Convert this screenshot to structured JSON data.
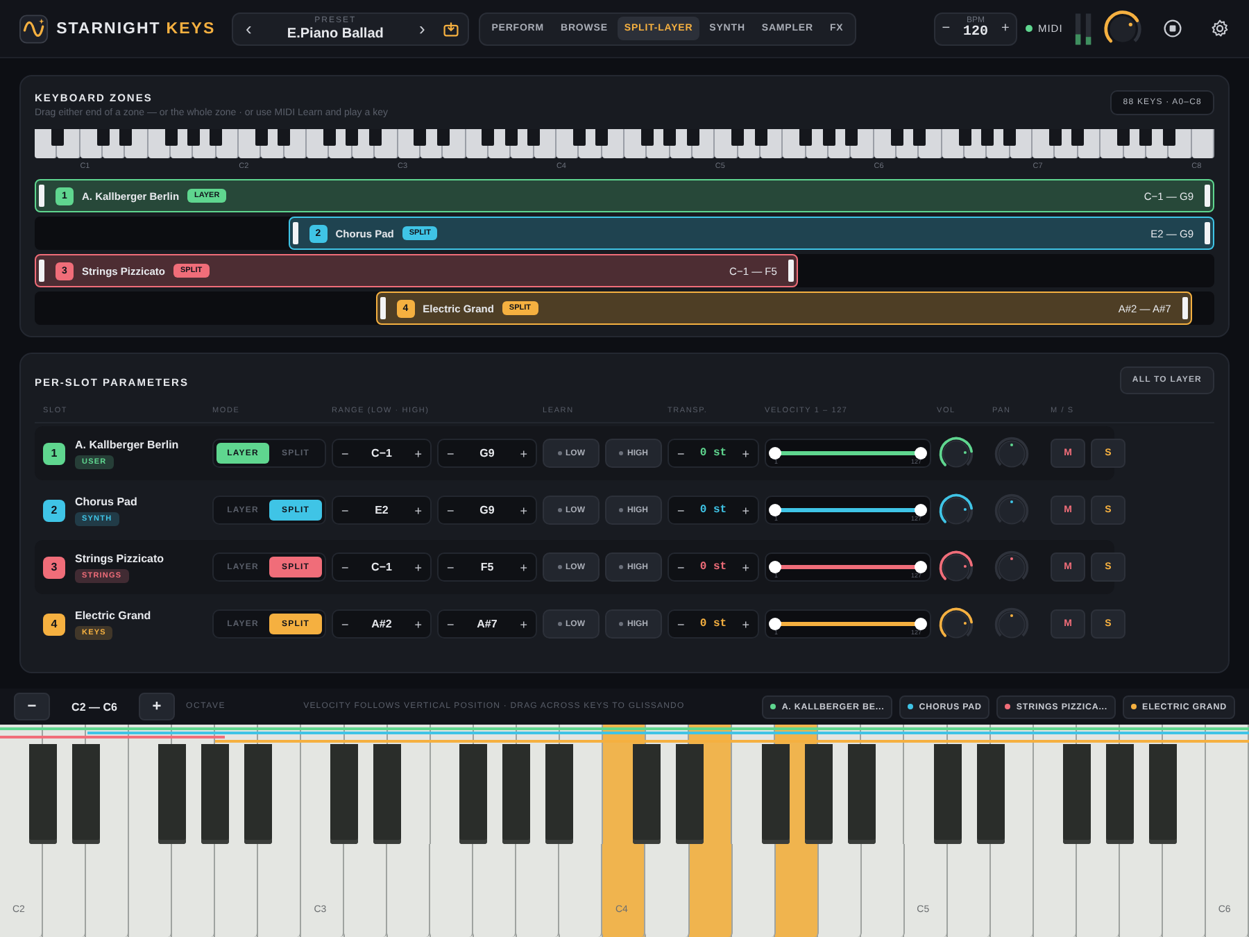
{
  "header": {
    "logo_text": "STARNIGHT",
    "logo_accent": "KEYS",
    "preset": {
      "prev": "‹",
      "label": "PRESET",
      "name": "E.Piano Ballad",
      "next": "›"
    },
    "tabs": [
      {
        "label": "PERFORM",
        "selected": false
      },
      {
        "label": "BROWSE",
        "selected": false
      },
      {
        "label": "SPLIT-LAYER",
        "selected": true
      },
      {
        "label": "SYNTH",
        "selected": false
      },
      {
        "label": "SAMPLER",
        "selected": false
      },
      {
        "label": "FX",
        "selected": false
      }
    ],
    "bpm": {
      "minus": "−",
      "label": "BPM",
      "value": "120",
      "plus": "+"
    },
    "midi": {
      "label": "MIDI",
      "on": true
    },
    "master": {
      "level": 0.72
    }
  },
  "zones_panel": {
    "title": "KEYBOARD ZONES",
    "subtitle": "Drag either end of a zone — or the whole zone · or use MIDI Learn and play a key",
    "badge": "88 KEYS · A0–C8",
    "octave_labels": [
      "C1",
      "C2",
      "C3",
      "C4",
      "C5",
      "C6",
      "C7",
      "C8"
    ],
    "zones": [
      {
        "number": "1",
        "name": "A. Kallberger Berlin",
        "mode": "LAYER",
        "range": "C−1 — G9",
        "color": "#5fd68f"
      },
      {
        "number": "2",
        "name": "Chorus Pad",
        "mode": "SPLIT",
        "range": "E2 — G9",
        "color": "#3fc4e6"
      },
      {
        "number": "3",
        "name": "Strings Pizzicato",
        "mode": "SPLIT",
        "range": "C−1 — F5",
        "color": "#f06d79"
      },
      {
        "number": "4",
        "name": "Electric Grand",
        "mode": "SPLIT",
        "range": "A#2 — A#7",
        "color": "#f5b040"
      }
    ]
  },
  "params_panel": {
    "title": "PER-SLOT PARAMETERS",
    "button": "ALL TO LAYER",
    "columns": [
      "SLOT",
      "MODE",
      "RANGE (LOW · HIGH)",
      "LEARN",
      "TRANSP.",
      "VELOCITY 1 – 127",
      "VOL",
      "PAN",
      "M / S"
    ],
    "slots": [
      {
        "number": "1",
        "name": "A. Kallberger Berlin",
        "category": "USER",
        "color": "#5fd68f",
        "modes": [
          {
            "label": "LAYER",
            "selected": true
          },
          {
            "label": "SPLIT",
            "selected": false
          }
        ],
        "low": {
          "minus": "−",
          "value": "C−1",
          "plus": "+"
        },
        "high": {
          "minus": "−",
          "value": "G9",
          "plus": "+"
        },
        "learn": [
          "LOW",
          "HIGH"
        ],
        "transpose": {
          "minus": "−",
          "value": "0 st",
          "plus": "+"
        },
        "velocity": {
          "level": 1,
          "min": "1",
          "max": "127"
        },
        "vol": {
          "level": 0.8
        },
        "pan": {
          "level": 0.5
        },
        "mute": "M",
        "solo": "S"
      },
      {
        "number": "2",
        "name": "Chorus Pad",
        "category": "SYNTH",
        "color": "#3fc4e6",
        "modes": [
          {
            "label": "LAYER",
            "selected": false
          },
          {
            "label": "SPLIT",
            "selected": true
          }
        ],
        "low": {
          "minus": "−",
          "value": "E2",
          "plus": "+"
        },
        "high": {
          "minus": "−",
          "value": "G9",
          "plus": "+"
        },
        "learn": [
          "LOW",
          "HIGH"
        ],
        "transpose": {
          "minus": "−",
          "value": "0 st",
          "plus": "+"
        },
        "velocity": {
          "level": 1,
          "min": "1",
          "max": "127"
        },
        "vol": {
          "level": 0.8
        },
        "pan": {
          "level": 0.5
        },
        "mute": "M",
        "solo": "S"
      },
      {
        "number": "3",
        "name": "Strings Pizzicato",
        "category": "STRINGS",
        "color": "#f06d79",
        "modes": [
          {
            "label": "LAYER",
            "selected": false
          },
          {
            "label": "SPLIT",
            "selected": true
          }
        ],
        "low": {
          "minus": "−",
          "value": "C−1",
          "plus": "+"
        },
        "high": {
          "minus": "−",
          "value": "F5",
          "plus": "+"
        },
        "learn": [
          "LOW",
          "HIGH"
        ],
        "transpose": {
          "minus": "−",
          "value": "0 st",
          "plus": "+"
        },
        "velocity": {
          "level": 1,
          "min": "1",
          "max": "127"
        },
        "vol": {
          "level": 0.8
        },
        "pan": {
          "level": 0.5
        },
        "mute": "M",
        "solo": "S"
      },
      {
        "number": "4",
        "name": "Electric Grand",
        "category": "KEYS",
        "color": "#f5b040",
        "modes": [
          {
            "label": "LAYER",
            "selected": false
          },
          {
            "label": "SPLIT",
            "selected": true
          }
        ],
        "low": {
          "minus": "−",
          "value": "A#2",
          "plus": "+"
        },
        "high": {
          "minus": "−",
          "value": "A#7",
          "plus": "+"
        },
        "learn": [
          "LOW",
          "HIGH"
        ],
        "transpose": {
          "minus": "−",
          "value": "0 st",
          "plus": "+"
        },
        "velocity": {
          "level": 1,
          "min": "1",
          "max": "127"
        },
        "vol": {
          "level": 0.8
        },
        "pan": {
          "level": 0.5
        },
        "mute": "M",
        "solo": "S"
      }
    ]
  },
  "keyboard_bar": {
    "minus": "−",
    "range": "C2 — C6",
    "plus": "+",
    "label": "OCTAVE",
    "hint": "VELOCITY FOLLOWS VERTICAL POSITION · DRAG ACROSS KEYS TO GLISSANDO",
    "legend": [
      {
        "label": "A. KALLBERGER BE...",
        "color": "#5fd68f"
      },
      {
        "label": "CHORUS PAD",
        "color": "#3fc4e6"
      },
      {
        "label": "STRINGS PIZZICA...",
        "color": "#f06d79"
      },
      {
        "label": "ELECTRIC GRAND",
        "color": "#f5b040"
      }
    ]
  },
  "keyboard": {
    "white_keys": [
      {
        "label": "C2",
        "pressed": false
      },
      {
        "pressed": false
      },
      {
        "pressed": false
      },
      {
        "pressed": false
      },
      {
        "pressed": false
      },
      {
        "pressed": false
      },
      {
        "pressed": false
      },
      {
        "label": "C3",
        "pressed": false
      },
      {
        "pressed": false
      },
      {
        "pressed": false
      },
      {
        "pressed": false
      },
      {
        "pressed": false
      },
      {
        "pressed": false
      },
      {
        "pressed": false
      },
      {
        "label": "C4",
        "pressed": true
      },
      {
        "pressed": false
      },
      {
        "pressed": true
      },
      {
        "pressed": false
      },
      {
        "pressed": true
      },
      {
        "pressed": false
      },
      {
        "pressed": false
      },
      {
        "label": "C5",
        "pressed": false
      },
      {
        "pressed": false
      },
      {
        "pressed": false
      },
      {
        "pressed": false
      },
      {
        "pressed": false
      },
      {
        "pressed": false
      },
      {
        "pressed": false
      },
      {
        "label": "C6",
        "pressed": false
      }
    ]
  }
}
